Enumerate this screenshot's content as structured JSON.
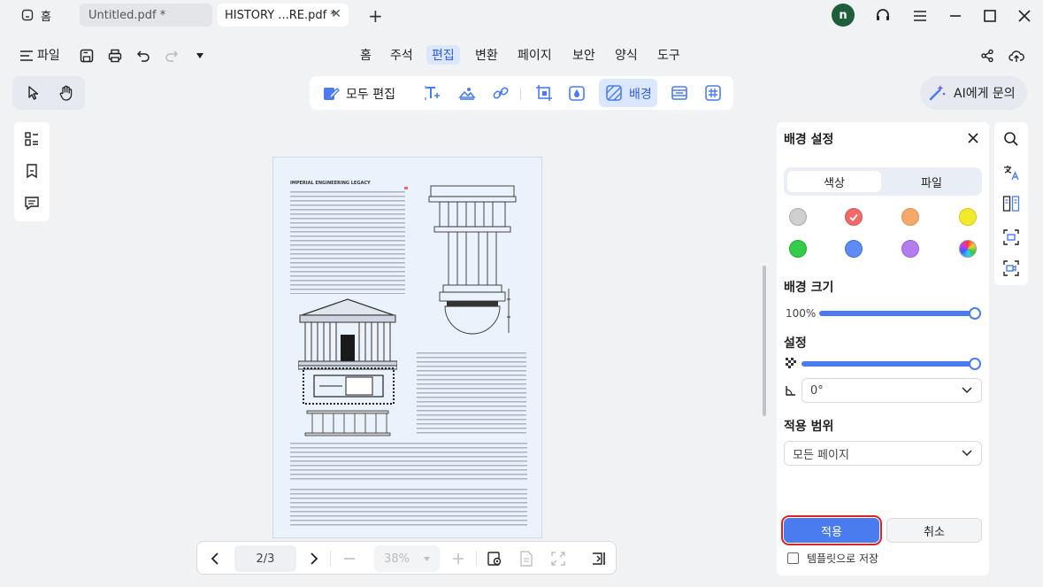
{
  "tabs": {
    "home_label": "홈",
    "tab1_label": "Untitled.pdf *",
    "tab2_label": "HISTORY ...RE.pdf *",
    "close": "✕",
    "add": "+"
  },
  "account": {
    "avatar_letter": "n"
  },
  "menu": {
    "file_label": "파일",
    "items": [
      "홈",
      "주석",
      "편집",
      "변환",
      "페이지",
      "보안",
      "양식",
      "도구"
    ]
  },
  "toolbar": {
    "edit_all_label": "모두 편집",
    "background_label": "배경",
    "ai_label": "AI에게 문의"
  },
  "document": {
    "title": "IMPERIAL ENGINEERING LEGACY"
  },
  "pagination": {
    "page_indicator": "2/3",
    "zoom": "38%"
  },
  "panel": {
    "title": "배경 설정",
    "tab_color": "색상",
    "tab_file": "파일",
    "colors": [
      "#cfcfcf",
      "#f06a6a",
      "#f5a86a",
      "#f2ea2c",
      "#34cc4a",
      "#5e8cf2",
      "#b57cf0",
      "rainbow"
    ],
    "size_title": "배경 크기",
    "size_value": "100%",
    "size_level": 1.0,
    "settings_title": "설정",
    "opacity_level": 1.0,
    "rotation_value": "0°",
    "range_title": "적용 범위",
    "range_value": "모든 페이지",
    "apply_label": "적용",
    "cancel_label": "취소",
    "save_template_label": "템플릿으로 저장"
  }
}
